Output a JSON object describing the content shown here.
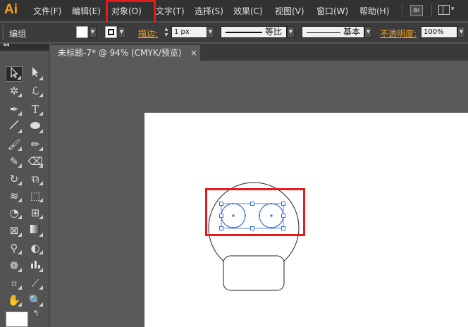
{
  "app": {
    "logo": "Ai"
  },
  "menu": {
    "items": [
      "文件(F)",
      "编辑(E)",
      "对象(O)",
      "文字(T)",
      "选择(S)",
      "效果(C)",
      "视图(V)",
      "窗口(W)",
      "帮助(H)"
    ],
    "highlighted": "对象(O)",
    "bridge_badge": "Br"
  },
  "control": {
    "mode": "编组",
    "stroke_label": "描边:",
    "stroke_weight": "1 px",
    "profile_label": "等比",
    "brush_label": "基本",
    "opacity_label": "不透明度:",
    "opacity_value": "100%"
  },
  "document": {
    "tab_title": "未标题-7* @ 94% (CMYK/预览)",
    "close_glyph": "×"
  },
  "toolbox": {
    "collapse_glyph": "◂◂",
    "swap_glyph": "↰"
  },
  "colors": {
    "accent_orange": "#f7a31c",
    "highlight_red": "#e21b1b",
    "selection_blue": "#3a6fd8"
  }
}
